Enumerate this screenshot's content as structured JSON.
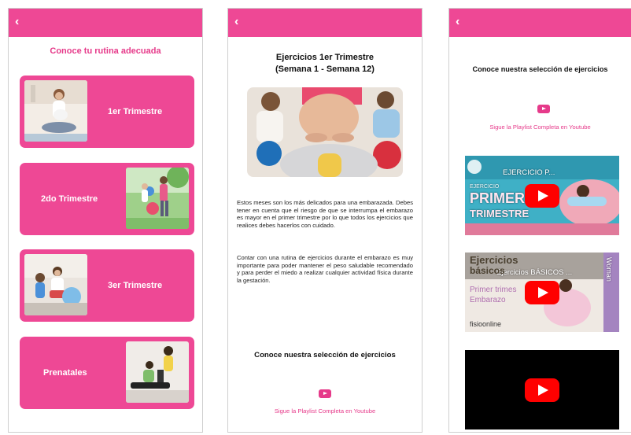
{
  "colors": {
    "accent": "#ee4895",
    "accent_text": "#e63a8a",
    "youtube_red": "#ff0000"
  },
  "common": {
    "back_icon": "‹"
  },
  "screen1": {
    "title": "Conoce tu rutina adecuada",
    "cards": [
      {
        "label": "1er Trimestre"
      },
      {
        "label": "2do Trimestre"
      },
      {
        "label": "3er Trimestre"
      },
      {
        "label": "Prenatales"
      }
    ]
  },
  "screen2": {
    "title_line1": "Ejercicios 1er Trimestre",
    "title_line2": "(Semana 1 - Semana 12)",
    "paragraph1": "Estos meses son los más delicados para una embarazada. Debes tener en cuenta que el riesgo de que se interrumpa el embarazo es mayor en el primer trimestre por lo que todos los ejercicios que realices debes hacerlos con cuidado.",
    "paragraph2": "Contar con una rutina de ejercicios durante el embarazo es muy importante para poder mantener el peso saludable recomendado y para perder el miedo a realizar cualquier actividad física durante la gestación.",
    "selection_heading": "Conoce nuestra selección de ejercicios",
    "playlist_link": "Sigue la Playlist Completa en Youtube"
  },
  "screen3": {
    "selection_heading": "Conoce nuestra selección de ejercicios",
    "playlist_link": "Sigue la Playlist Completa en Youtube",
    "videos": [
      {
        "title": "EJERCICIO P...",
        "overlay_line1": "EJERCICIO",
        "overlay_line2": "PRIMER",
        "overlay_line3": "TRIMESTRE"
      },
      {
        "title": "Ejercicios BÁSICOS ...",
        "overlay_line1": "Ejercicios",
        "overlay_line2": "básicos",
        "overlay_line3": "Primer trimes",
        "overlay_line4": "Embarazo",
        "brand": "fisioonline",
        "side_text": "Woman"
      },
      {
        "title": ""
      }
    ]
  }
}
